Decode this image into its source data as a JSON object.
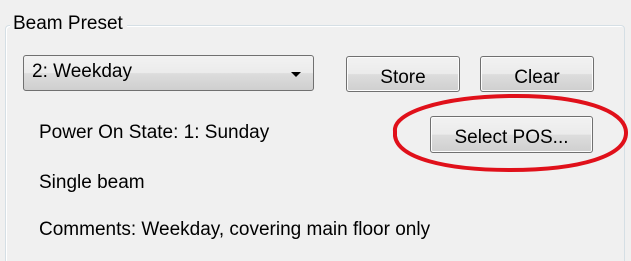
{
  "beam_preset": {
    "group_title": "Beam Preset",
    "combo_value": "2: Weekday",
    "store_label": "Store",
    "clear_label": "Clear",
    "power_on_state": "Power On State:  1: Sunday",
    "select_pos_label": "Select POS...",
    "beam_mode": "Single beam",
    "comments": "Comments:  Weekday,  covering main floor only"
  },
  "annotation": {
    "highlight_color": "#e0101a"
  }
}
